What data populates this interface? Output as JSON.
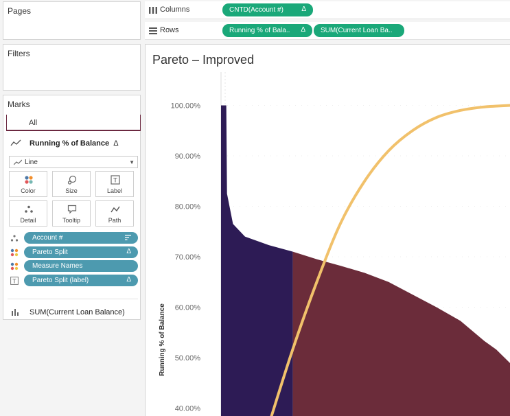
{
  "pages": {
    "title": "Pages"
  },
  "filters": {
    "title": "Filters"
  },
  "marks": {
    "title": "Marks",
    "all_tab": "All",
    "section_title": "Running % of Balance",
    "section_delta": "Δ",
    "mark_type": "Line",
    "buttons": [
      {
        "label": "Color"
      },
      {
        "label": "Size"
      },
      {
        "label": "Label"
      },
      {
        "label": "Detail"
      },
      {
        "label": "Tooltip"
      },
      {
        "label": "Path"
      }
    ],
    "fields": [
      {
        "label": "Account #",
        "type": "detail",
        "suffix": ""
      },
      {
        "label": "Pareto Split",
        "type": "color",
        "suffix": "Δ"
      },
      {
        "label": "Measure Names",
        "type": "color",
        "suffix": ""
      },
      {
        "label": "Pareto Split (label)",
        "type": "label",
        "suffix": "Δ"
      }
    ],
    "second_section": "SUM(Current Loan Balance)"
  },
  "shelves": {
    "columns_label": "Columns",
    "rows_label": "Rows",
    "columns_pill": "CNTD(Account #)",
    "columns_pill_delta": "Δ",
    "rows_pills": [
      {
        "label": "Running % of Bala..",
        "delta": "Δ"
      },
      {
        "label": "SUM(Current Loan Ba..",
        "delta": ""
      }
    ]
  },
  "view": {
    "title": "Pareto – Improved"
  },
  "chart_data": {
    "type": "area",
    "ylabel": "Running % of Balance",
    "yticks": [
      "100.00%",
      "90.00%",
      "80.00%",
      "70.00%",
      "60.00%",
      "50.00%",
      "40.00%"
    ],
    "y_tick_values": [
      100,
      90,
      80,
      70,
      60,
      50,
      40
    ],
    "ylim": [
      38.3,
      106.6
    ],
    "x_fraction_range": [
      0,
      1.21
    ],
    "split_at_fraction": 0.3,
    "colors": {
      "top_segment": "#2d1b55",
      "rest_segment": "#6b2c3a",
      "cumulative_line": "#f1c16b"
    },
    "bar_curve": [
      {
        "x": 0.0,
        "y": 100.0
      },
      {
        "x": 0.022,
        "y": 100.0
      },
      {
        "x": 0.025,
        "y": 82.5
      },
      {
        "x": 0.05,
        "y": 76.5
      },
      {
        "x": 0.1,
        "y": 74.0
      },
      {
        "x": 0.2,
        "y": 72.3
      },
      {
        "x": 0.3,
        "y": 71.0
      },
      {
        "x": 0.4,
        "y": 69.5
      },
      {
        "x": 0.5,
        "y": 68.2
      },
      {
        "x": 0.6,
        "y": 66.8
      },
      {
        "x": 0.7,
        "y": 65.0
      },
      {
        "x": 0.8,
        "y": 62.5
      },
      {
        "x": 0.9,
        "y": 60.0
      },
      {
        "x": 1.0,
        "y": 57.3
      },
      {
        "x": 1.1,
        "y": 53.3
      },
      {
        "x": 1.15,
        "y": 51.6
      },
      {
        "x": 1.21,
        "y": 48.8
      }
    ],
    "cumulative_line": [
      {
        "x": 0.21,
        "y": 38.3
      },
      {
        "x": 0.3,
        "y": 51.7
      },
      {
        "x": 0.4,
        "y": 65.0
      },
      {
        "x": 0.5,
        "y": 76.7
      },
      {
        "x": 0.6,
        "y": 85.0
      },
      {
        "x": 0.7,
        "y": 91.0
      },
      {
        "x": 0.8,
        "y": 95.0
      },
      {
        "x": 0.9,
        "y": 97.6
      },
      {
        "x": 1.0,
        "y": 99.0
      },
      {
        "x": 1.1,
        "y": 99.7
      },
      {
        "x": 1.21,
        "y": 100.0
      }
    ]
  }
}
